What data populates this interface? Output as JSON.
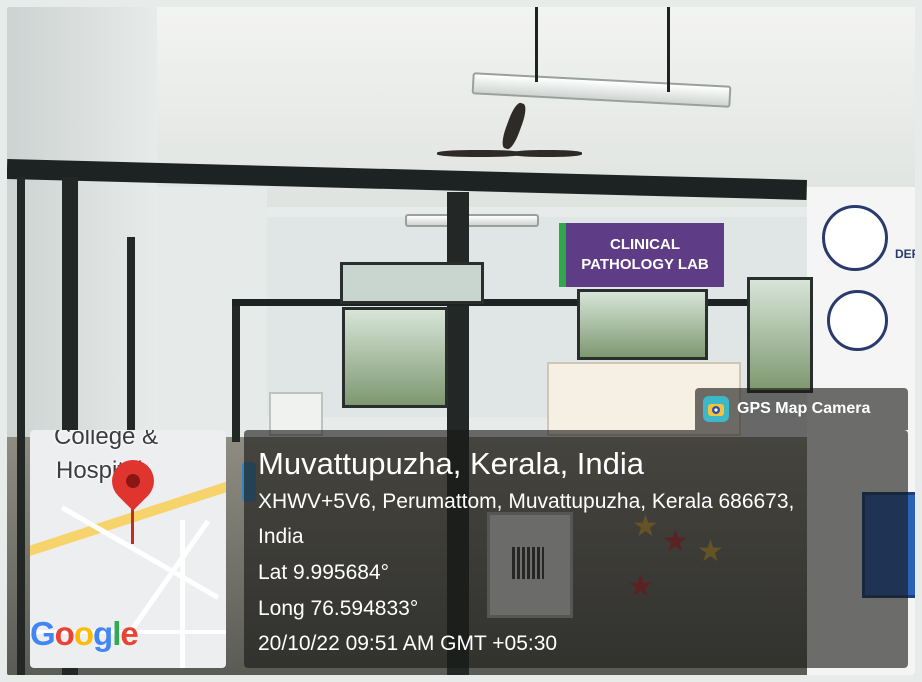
{
  "scene": {
    "lab_sign": [
      "CLINICAL",
      "PATHOLOGY LAB"
    ],
    "wall_text": "DEPA"
  },
  "map": {
    "labels": [
      "College &",
      "Hospital"
    ],
    "logo": "Google",
    "colors": {
      "road": "#f7d46b",
      "pin": "#e0342f"
    }
  },
  "app": {
    "name": "GPS Map Camera",
    "icon": "map-camera-icon"
  },
  "location": {
    "title": "Muvattupuzha, Kerala, India",
    "address_line1": "XHWV+5V6, Perumattom, Muvattupuzha, Kerala 686673,",
    "address_line2": "India",
    "lat": "Lat 9.995684°",
    "long": "Long 76.594833°",
    "datetime": "20/10/22 09:51 AM GMT +05:30"
  }
}
